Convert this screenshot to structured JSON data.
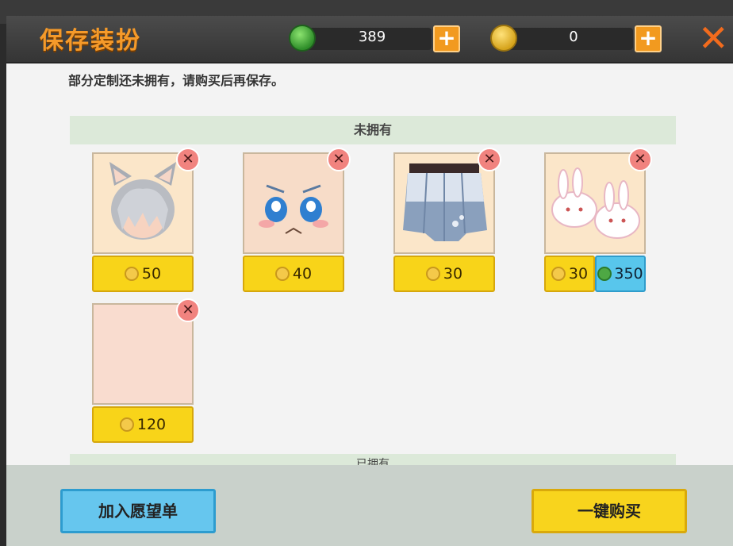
{
  "header": {
    "title": "保存装扮",
    "gem_count": "389",
    "coin_count": "0",
    "close_symbol": "✕"
  },
  "message": "部分定制还未拥有，请购买后再保存。",
  "section_not_owned": "未拥有",
  "section_owned": "已拥有",
  "items": [
    {
      "name": "cat-ear-hair",
      "coin_price": "50"
    },
    {
      "name": "crying-face",
      "coin_price": "40"
    },
    {
      "name": "skirt",
      "coin_price": "30"
    },
    {
      "name": "bunny-slippers",
      "coin_price": "30",
      "gem_price": "350"
    },
    {
      "name": "skin-tone",
      "coin_price": "120"
    }
  ],
  "buttons": {
    "wishlist": "加入愿望单",
    "buy_all": "一键购买",
    "plus": "+"
  },
  "colors": {
    "accent_orange": "#f59a2a",
    "price_yellow": "#f8d419",
    "price_blue": "#58c6ec",
    "remove_red": "#f1837f"
  }
}
